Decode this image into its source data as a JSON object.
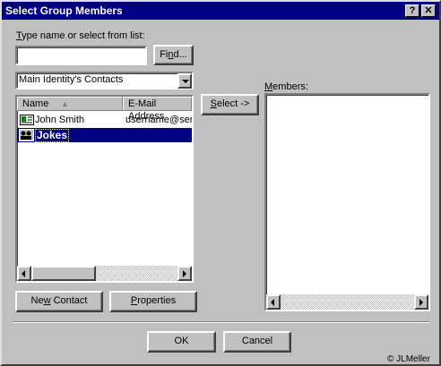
{
  "window": {
    "title": "Select Group Members",
    "help_label": "?",
    "close_label": "✕"
  },
  "search": {
    "label_prefix": "T",
    "label_rest": "ype name or select from list:",
    "value": "",
    "find_label_prefix": "Fi",
    "find_label_accel": "n",
    "find_label_rest": "d..."
  },
  "source": {
    "selected": "Main Identity's Contacts"
  },
  "contacts": {
    "columns": {
      "name": "Name",
      "email": "E-Mail Address",
      "sort_indicator": "▲"
    },
    "rows": [
      {
        "name": "John Smith",
        "email": "username@serv",
        "icon": "contact-card-icon",
        "selected": false
      },
      {
        "name": "Jokes",
        "email": "",
        "icon": "group-icon",
        "selected": true
      }
    ]
  },
  "select_button": {
    "accel": "S",
    "rest": "elect ->"
  },
  "members": {
    "label_prefix": "M",
    "label_rest": "embers:"
  },
  "buttons": {
    "new_contact_prefix": "Ne",
    "new_contact_accel": "w",
    "new_contact_rest": " Contact",
    "properties_accel": "P",
    "properties_rest": "roperties",
    "ok": "OK",
    "cancel": "Cancel"
  },
  "watermark": "© JLMeller",
  "colors": {
    "title_bar": "#000080",
    "face": "#c0c0c0",
    "selection": "#000080"
  }
}
